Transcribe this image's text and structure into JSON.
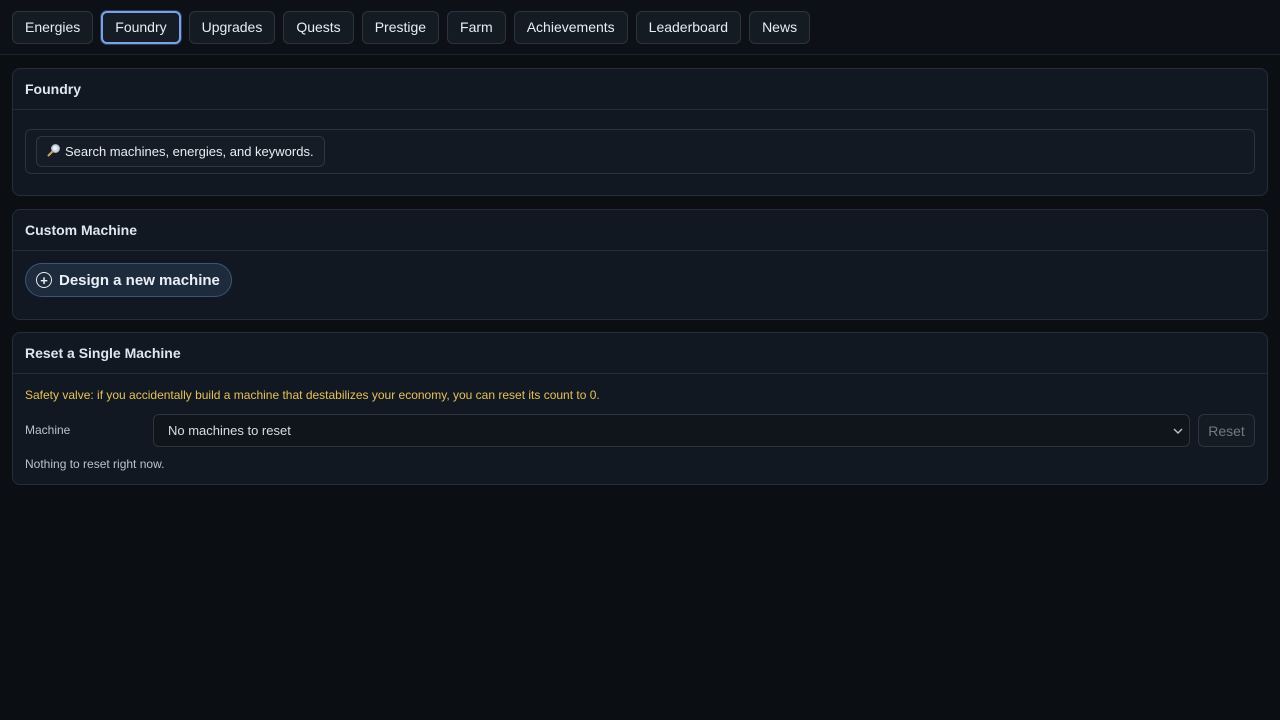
{
  "tabs": [
    {
      "label": "Energies"
    },
    {
      "label": "Foundry"
    },
    {
      "label": "Upgrades"
    },
    {
      "label": "Quests"
    },
    {
      "label": "Prestige"
    },
    {
      "label": "Farm"
    },
    {
      "label": "Achievements"
    },
    {
      "label": "Leaderboard"
    },
    {
      "label": "News"
    }
  ],
  "active_tab": "Foundry",
  "foundry": {
    "title": "Foundry",
    "search_icon": "magnifier-icon",
    "search_label": "Search machines, energies, and keywords."
  },
  "custom_machine": {
    "title": "Custom Machine",
    "design_label": "Design a new machine"
  },
  "reset": {
    "title": "Reset a Single Machine",
    "warning": "Safety valve: if you accidentally build a machine that destabilizes your economy, you can reset its count to 0.",
    "machine_label": "Machine",
    "select_value": "No machines to reset",
    "reset_label": "Reset",
    "empty_text": "Nothing to reset right now."
  },
  "colors": {
    "background": "#0b0f13",
    "panel": "#121821",
    "accent": "#7aa2e6",
    "warning": "#e5c15b"
  }
}
